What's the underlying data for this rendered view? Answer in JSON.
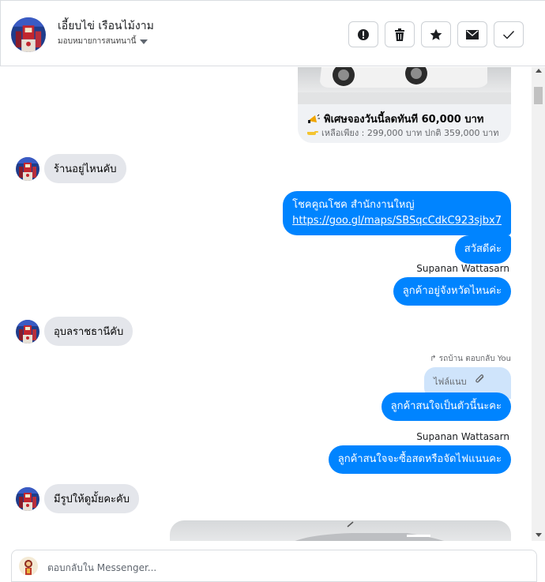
{
  "header": {
    "contact_name": "เอี้ยบไข่ เรือนไม้งาม",
    "assign_label": "มอบหมายการสนทนานี้",
    "actions": [
      "report-icon",
      "trash-icon",
      "star-icon",
      "mail-icon",
      "check-icon"
    ]
  },
  "card": {
    "title": "พิเศษจองวันนี้ลดทันที 60,000 บาท",
    "subtitle": "เหลือเพียง : 299,000 บาท ปกติ 359,000 บาท"
  },
  "messages": {
    "m1": "ร้านอยู่ไหนคับ",
    "m2_line1": "โชคคูณโชค สำนักงานใหญ่",
    "m2_link": "https://goo.gl/maps/SBSqcCdkC923sjbx7",
    "m3": "สวัสดีค่ะ",
    "sender1": "Supanan Wattasarn",
    "m4": "ลูกค้าอยู่จังหวัดไหนค่ะ",
    "m5": "อุบลราชธานีคับ",
    "reply_meta": "รถบ้าน ตอบกลับ You",
    "reply_quote": "ไฟล์แนบ",
    "m6": "ลูกค้าสนใจเป็นตัวนี้นะคะ",
    "sender2": "Supanan Wattasarn",
    "m7": "ลูกค้าสนใจจะซื้อสดหรือจัดไฟแนนคะ",
    "m8": "มีรูปให้ดูมั้ยคะคับ"
  },
  "composer": {
    "placeholder": "ตอบกลับใน Messenger..."
  },
  "colors": {
    "outgoing_bubble": "#0084ff",
    "incoming_bubble": "#e4e6eb",
    "reply_quote_bg": "#cfe4fb"
  }
}
